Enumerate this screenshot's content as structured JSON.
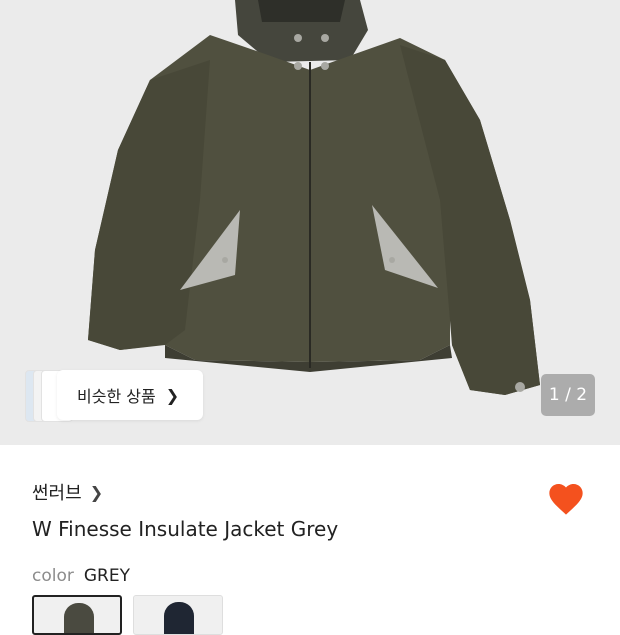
{
  "gallery": {
    "similar_label": "비슷한 상품",
    "page_indicator": "1 / 2"
  },
  "product": {
    "brand": "썬러브",
    "title": "W Finesse Insulate Jacket Grey",
    "color_label": "color",
    "color_value": "GREY",
    "liked": true,
    "heart_color": "#f4511e",
    "swatches": [
      {
        "name": "olive-grey",
        "color": "#4a4a40",
        "selected": true
      },
      {
        "name": "navy",
        "color": "#1f2633",
        "selected": false
      }
    ]
  }
}
